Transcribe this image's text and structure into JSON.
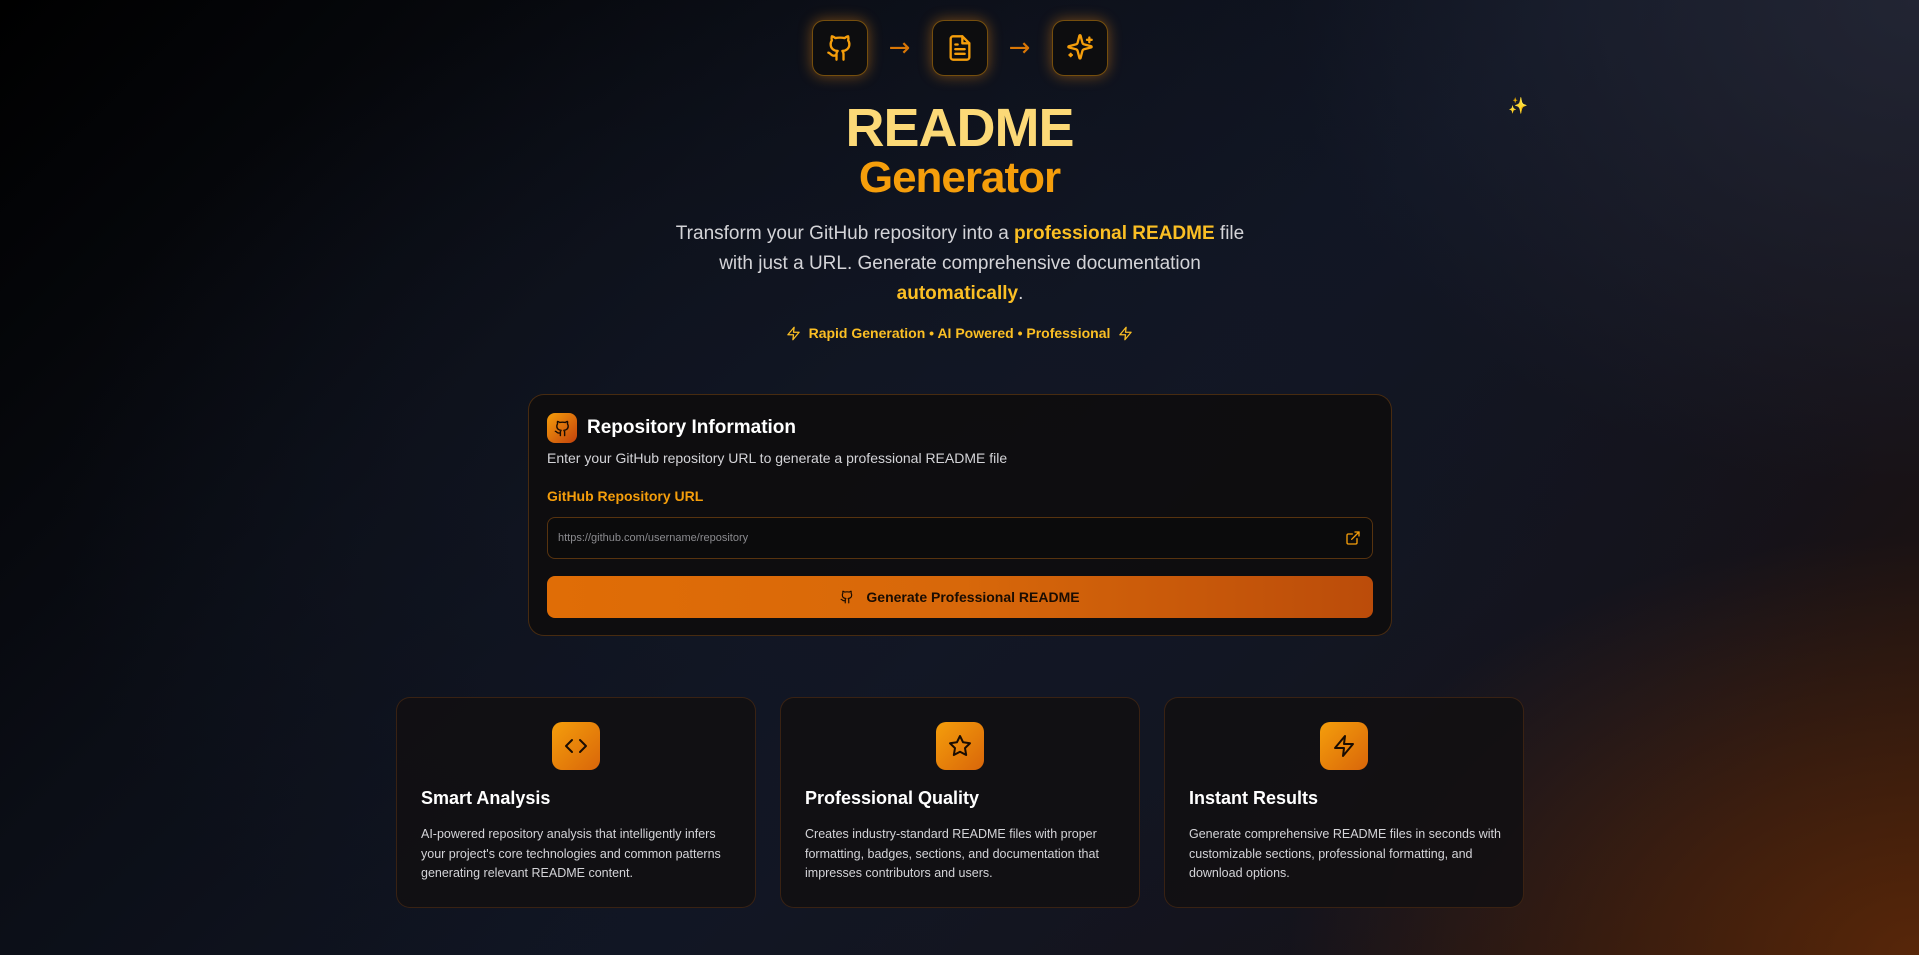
{
  "hero": {
    "steps": [
      "github-icon",
      "document-icon",
      "sparkles-icon"
    ],
    "arrow": "→",
    "sparkle": "✨",
    "title_line1": "README",
    "title_line2": "Generator",
    "subtitle": {
      "part1": "Transform your GitHub repository into a ",
      "highlight1": "professional README",
      "part2": " file with just a URL. Generate comprehensive documentation ",
      "highlight2": "automatically",
      "part3": "."
    },
    "tagline": "Rapid Generation • AI Powered • Professional"
  },
  "repo_card": {
    "title": "Repository Information",
    "description": "Enter your GitHub repository URL to generate a professional README file",
    "field_label": "GitHub Repository URL",
    "input_value": "",
    "input_placeholder": "https://github.com/username/repository",
    "button_label": "Generate Professional README"
  },
  "features": [
    {
      "icon": "code-icon",
      "title": "Smart Analysis",
      "description": "AI-powered repository analysis that intelligently infers your project's core technologies and common patterns generating relevant README content."
    },
    {
      "icon": "star-icon",
      "title": "Professional Quality",
      "description": "Creates industry-standard README files with proper formatting, badges, sections, and documentation that impresses contributors and users."
    },
    {
      "icon": "lightning-icon",
      "title": "Instant Results",
      "description": "Generate comprehensive README files in seconds with customizable sections, professional formatting, and download options."
    }
  ],
  "colors": {
    "accent": "#f59e0b",
    "title_light": "#fcd977",
    "button": "#d8680a"
  }
}
